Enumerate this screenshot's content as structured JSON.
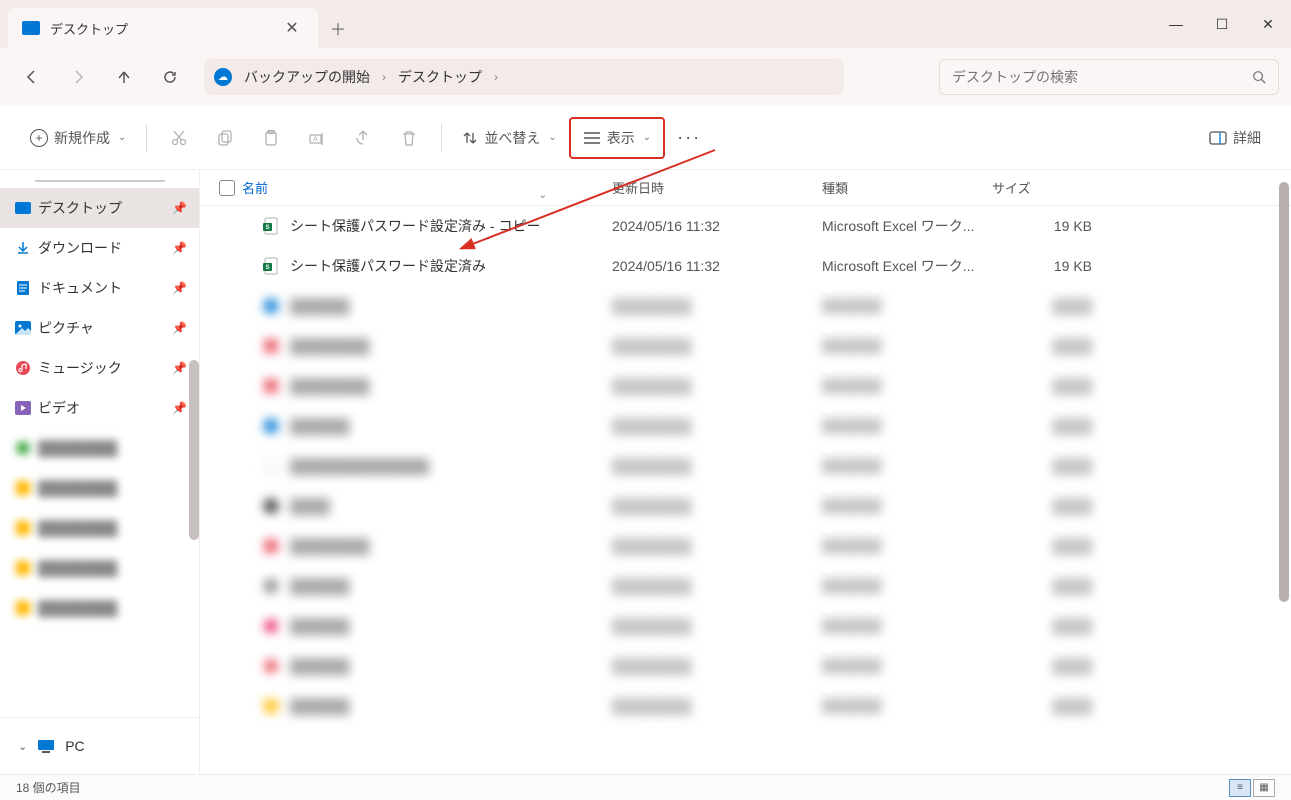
{
  "tab": {
    "title": "デスクトップ"
  },
  "breadcrumb": {
    "backup_label": "バックアップの開始",
    "items": [
      "デスクトップ"
    ]
  },
  "search": {
    "placeholder": "デスクトップの検索"
  },
  "toolbar": {
    "new_label": "新規作成",
    "sort_label": "並べ替え",
    "view_label": "表示",
    "details_label": "詳細"
  },
  "sidebar": {
    "items": [
      {
        "label": "デスクトップ",
        "icon": "desktop",
        "pinned": true,
        "active": true
      },
      {
        "label": "ダウンロード",
        "icon": "download",
        "pinned": true
      },
      {
        "label": "ドキュメント",
        "icon": "document",
        "pinned": true
      },
      {
        "label": "ピクチャ",
        "icon": "picture",
        "pinned": true
      },
      {
        "label": "ミュージック",
        "icon": "music",
        "pinned": true
      },
      {
        "label": "ビデオ",
        "icon": "video",
        "pinned": true
      }
    ],
    "pc_label": "PC"
  },
  "columns": {
    "name": "名前",
    "date": "更新日時",
    "type": "種類",
    "size": "サイズ"
  },
  "files": [
    {
      "name": "シート保護パスワード設定済み - コピー",
      "date": "2024/05/16 11:32",
      "type": "Microsoft Excel ワーク...",
      "size": "19 KB",
      "icon": "excel"
    },
    {
      "name": "シート保護パスワード設定済み",
      "date": "2024/05/16 11:32",
      "type": "Microsoft Excel ワーク...",
      "size": "19 KB",
      "icon": "excel"
    }
  ],
  "status": {
    "items_label": "18 個の項目"
  }
}
